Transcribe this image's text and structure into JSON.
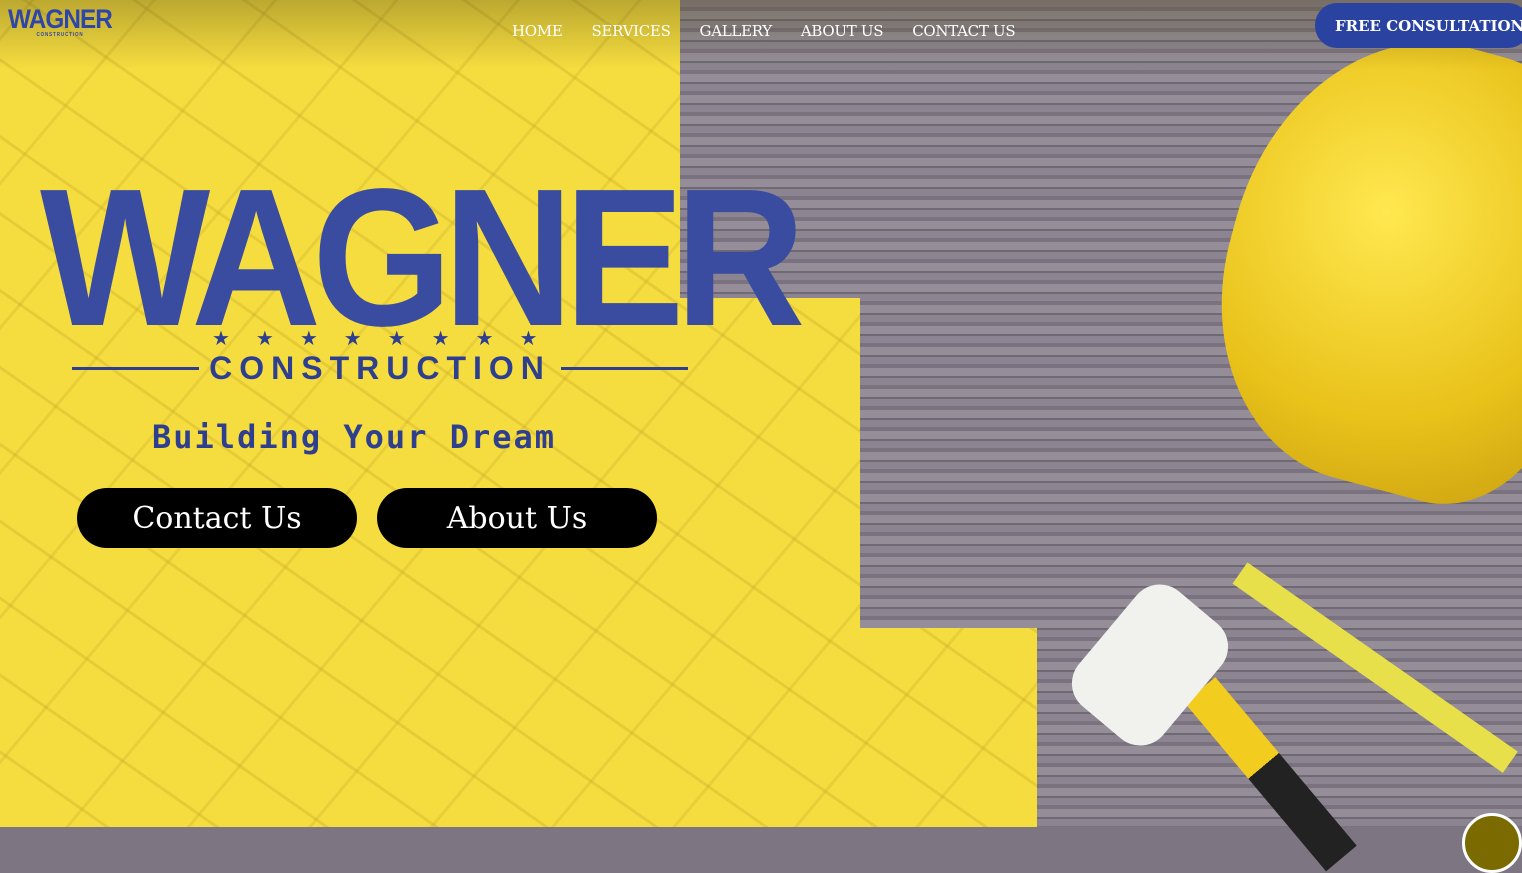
{
  "header": {
    "logo": "WAGNER",
    "logo_sub": "CONSTRUCTION",
    "nav": [
      "HOME",
      "SERVICES",
      "GALLERY",
      "ABOUT US",
      "CONTACT US"
    ],
    "cta": "FREE CONSULTATION"
  },
  "hero": {
    "title": "WAGNER",
    "stars": "★★★★★★★★",
    "subtitle": "CONSTRUCTION",
    "tagline": "Building Your Dream",
    "buttons": [
      "Contact Us",
      "About Us"
    ]
  }
}
